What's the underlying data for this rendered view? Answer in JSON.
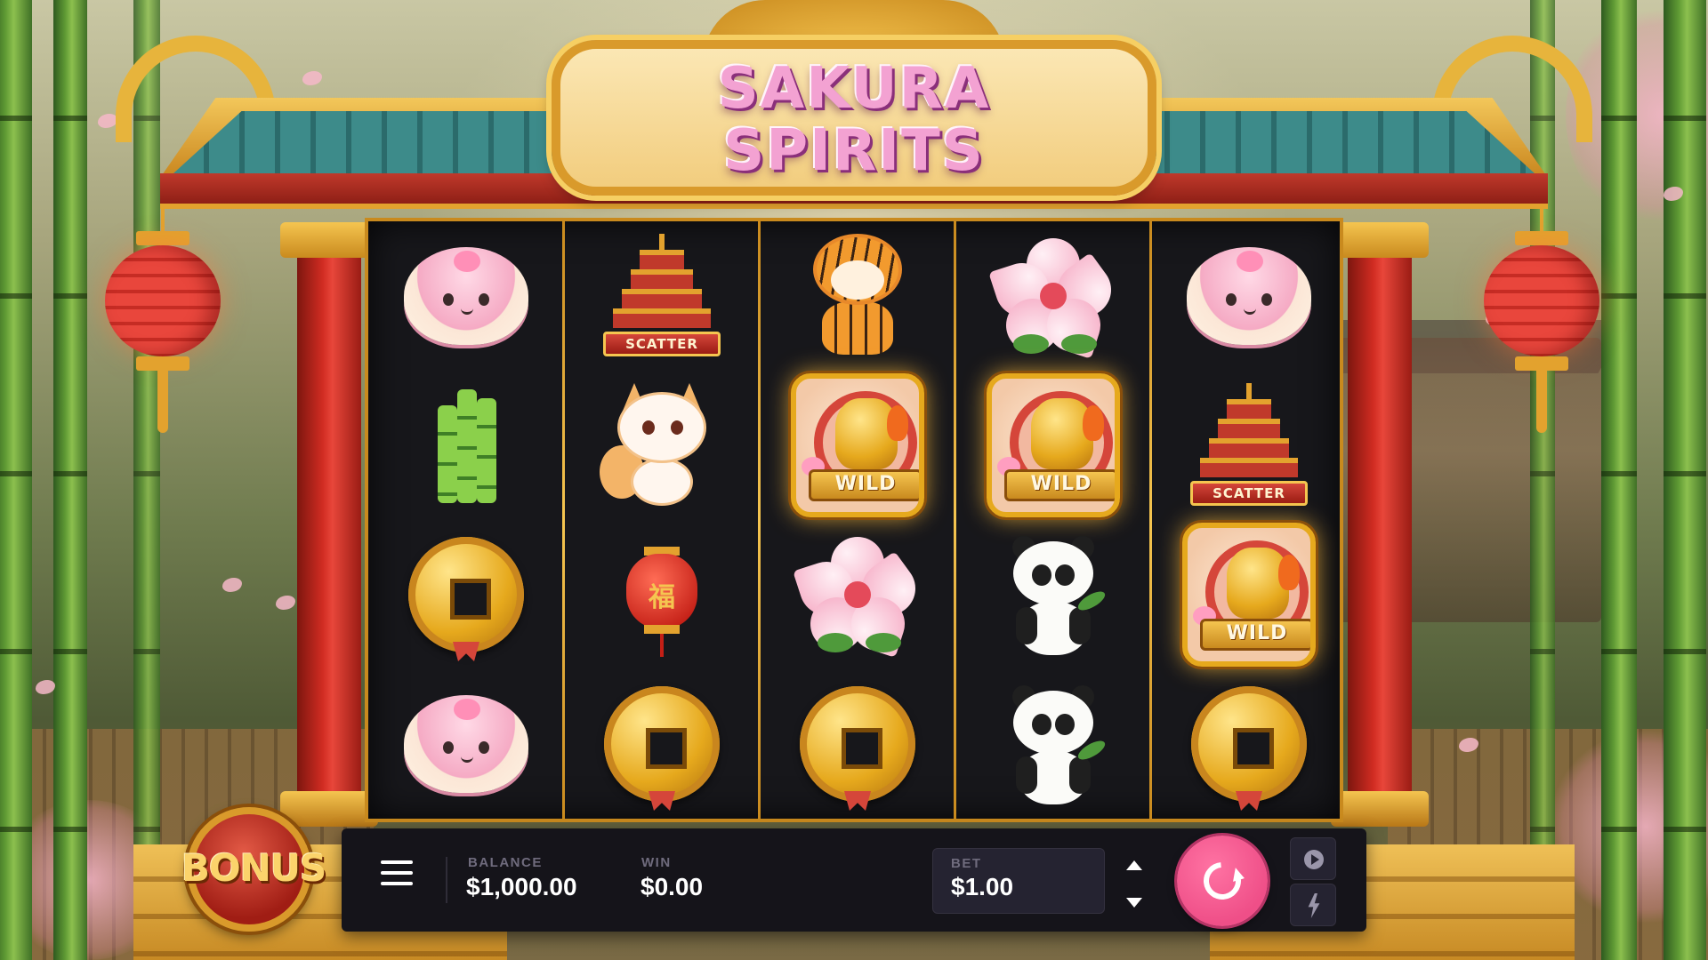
{
  "game": {
    "title": "SAKURA\nSPIRITS"
  },
  "reels": {
    "columns": [
      [
        "mochi",
        "bamboo",
        "coin",
        "mochi"
      ],
      [
        "pagoda-scatter",
        "fox",
        "lantern",
        "coin"
      ],
      [
        "tiger",
        "dragon-wild",
        "cherry-blossom",
        "coin"
      ],
      [
        "cherry-blossom",
        "dragon-wild",
        "panda",
        "panda"
      ],
      [
        "mochi",
        "pagoda-scatter",
        "dragon-wild",
        "coin"
      ]
    ],
    "scatter_label": "SCATTER",
    "wild_label": "WILD",
    "lantern_glyph": "福"
  },
  "hud": {
    "balance_label": "BALANCE",
    "balance_value": "$1,000.00",
    "win_label": "WIN",
    "win_value": "$0.00",
    "bet_label": "BET",
    "bet_value": "$1.00"
  },
  "bonus": {
    "label": "BONUS"
  },
  "icons": {
    "menu": "hamburger-menu-icon",
    "spin": "refresh-spin-icon",
    "autoplay": "play-circle-icon",
    "turbo": "lightning-bolt-icon",
    "bet_up": "chevron-up-icon",
    "bet_down": "chevron-down-icon"
  },
  "colors": {
    "spin_button": "#ef4f88",
    "hud_background": "#15141a",
    "reel_background": "#17171b",
    "gold_trim": "#c98a1e",
    "pillar_red": "#d12c22"
  }
}
